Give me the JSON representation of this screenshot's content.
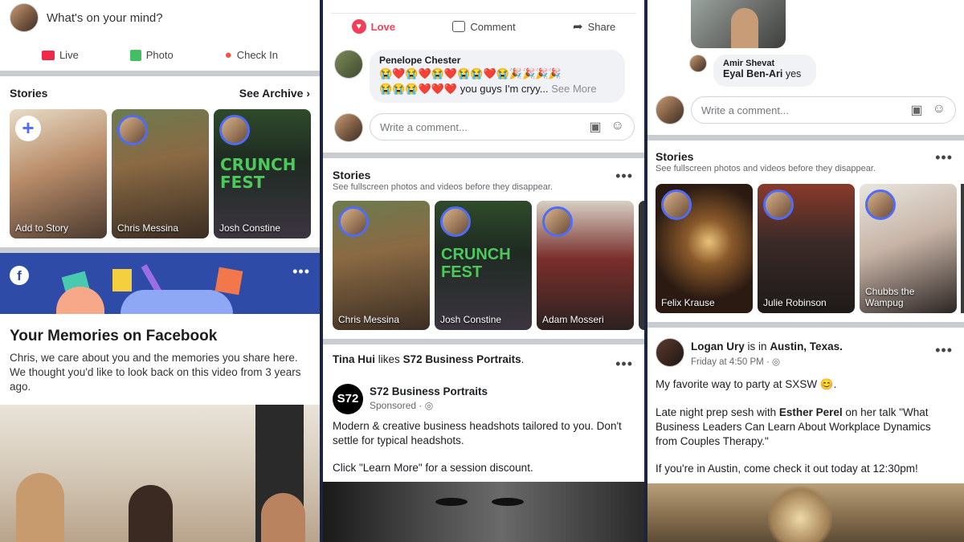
{
  "panel1": {
    "composer": {
      "placeholder": "What's on your mind?"
    },
    "actions": [
      {
        "label": "Live"
      },
      {
        "label": "Photo"
      },
      {
        "label": "Check In"
      }
    ],
    "stories": {
      "title": "Stories",
      "archive": "See Archive",
      "items": [
        {
          "name": "Add to Story"
        },
        {
          "name": "Chris Messina"
        },
        {
          "name": "Josh Constine"
        }
      ]
    },
    "memories": {
      "title": "Your Memories on Facebook",
      "body": "Chris, we care about you and the memories you share here. We thought you'd like to look back on this video from 3 years ago."
    }
  },
  "panel2": {
    "actions": [
      {
        "label": "Love"
      },
      {
        "label": "Comment"
      },
      {
        "label": "Share"
      }
    ],
    "comment": {
      "author": "Penelope Chester",
      "line1": "😭❤️😭❤️😭❤️😭😭❤️😭🎉🎉🎉🎉",
      "line2": "😭😭😭❤️❤️❤️ you guys I'm cryy...",
      "see_more": "See More"
    },
    "write_placeholder": "Write a comment...",
    "stories": {
      "title": "Stories",
      "subtitle": "See fullscreen photos and videos before they disappear.",
      "items": [
        {
          "name": "Chris Messina"
        },
        {
          "name": "Josh Constine"
        },
        {
          "name": "Adam Mosseri"
        }
      ]
    },
    "activity": {
      "actor": "Tina Hui",
      "verb": "likes",
      "page": "S72 Business Portraits"
    },
    "ad": {
      "logo": "S72",
      "name": "S72 Business Portraits",
      "sponsored": "Sponsored · ",
      "body1": "Modern & creative business headshots tailored to you. Don't settle for typical headshots.",
      "body2": "Click \"Learn More\" for a session discount."
    }
  },
  "panel3": {
    "reply": {
      "name1": "Amir Shevat",
      "name2": "Eyal Ben-Ari",
      "suffix": "yes"
    },
    "write_placeholder": "Write a comment...",
    "stories": {
      "title": "Stories",
      "subtitle": "See fullscreen photos and videos before they disappear.",
      "items": [
        {
          "name": "Felix Krause"
        },
        {
          "name": "Julie Robinson"
        },
        {
          "name": "Chubbs the Wampug"
        }
      ]
    },
    "post": {
      "author": "Logan Ury",
      "is_in": "is in",
      "place": "Austin, Texas.",
      "time": "Friday at 4:50 PM · ",
      "p1": "My favorite way to party at SXSW 😊.",
      "p2a": "Late night prep sesh with ",
      "p2b": "Esther Perel",
      "p2c": " on her talk \"What Business Leaders Can Learn About Workplace Dynamics from Couples Therapy.\"",
      "p3": "If you're in Austin, come check it out today at 12:30pm!"
    }
  },
  "colors": {
    "brand": "#3b5998",
    "love": "#f33e58",
    "story_ring": "#4f6cf7",
    "live": "#f02849",
    "photo": "#45bd62",
    "checkin": "#f5533d"
  }
}
